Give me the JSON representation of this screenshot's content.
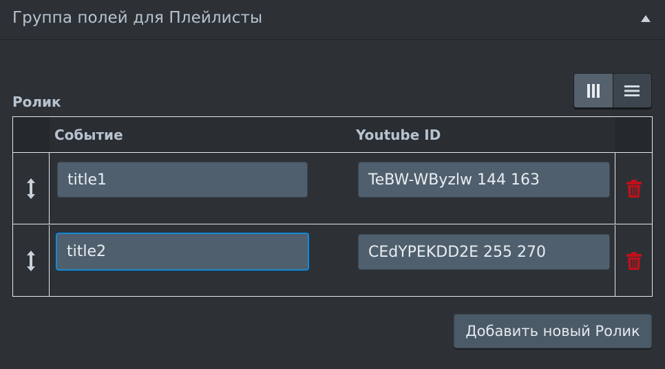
{
  "panel": {
    "title": "Группа полей для Плейлисты",
    "collapse_icon": "chevron-up-icon"
  },
  "field": {
    "label": "Ролик",
    "layout_options": [
      "table-layout-icon",
      "list-layout-icon"
    ],
    "active_layout": "table"
  },
  "table": {
    "columns": [
      "Событие",
      "Youtube ID"
    ],
    "rows": [
      {
        "event": "title1",
        "youtube_id": "TeBW-WByzlw 144 163"
      },
      {
        "event": "title2",
        "youtube_id": "CEdYPEKDD2E 255 270"
      }
    ]
  },
  "add_button_label": "Добавить новый Ролик",
  "colors": {
    "background": "#2d3136",
    "input": "#4f5f6d",
    "focus": "#1f86c9",
    "delete": "#c0101a"
  }
}
